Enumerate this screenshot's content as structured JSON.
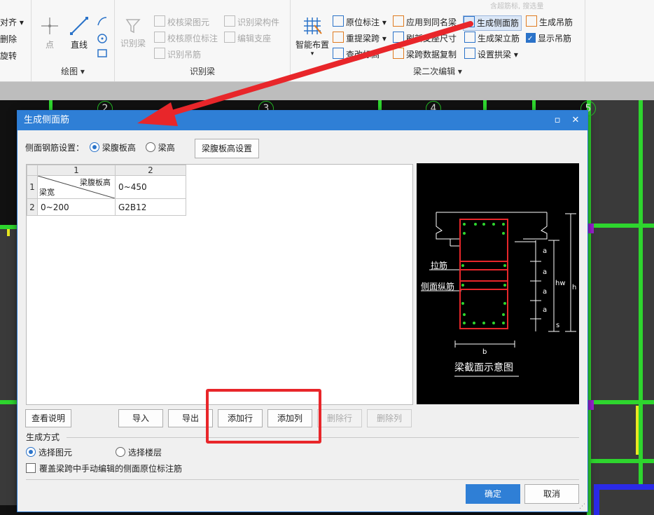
{
  "ribbon": {
    "left_items": [
      "对齐",
      "删除",
      "旋转"
    ],
    "draw_group": {
      "title": "绘图",
      "point": "点",
      "line": "直线"
    },
    "identify_group": {
      "title": "识别梁",
      "big": "识别梁",
      "items": [
        "校核梁图元",
        "校核原位标注",
        "识别吊筋",
        "识别梁构件",
        "编辑支座"
      ]
    },
    "edit_group": {
      "title": "梁二次编辑",
      "smart": "智能布置",
      "items": [
        "原位标注",
        "重提梁跨",
        "查改标高",
        "应用到同名梁",
        "刷新支座尺寸",
        "梁跨数据复制",
        "生成侧面筋",
        "生成架立筋",
        "设置拱梁",
        "生成吊筋",
        "显示吊筋"
      ]
    },
    "overflow_text": "含超筋标, 搜选量"
  },
  "canvas": {
    "axis_labels": [
      "2",
      "3",
      "4",
      "5"
    ]
  },
  "dialog": {
    "title": "生成侧面筋",
    "setting_label": "侧面钢筋设置：",
    "radio_web": "梁腹板高",
    "radio_height": "梁高",
    "web_settings_button": "梁腹板高设置",
    "table": {
      "col_headers": [
        "1",
        "2"
      ],
      "row_headers": [
        "1",
        "2"
      ],
      "diag_top": "梁腹板高",
      "diag_bottom": "梁宽",
      "header_value": "0~450",
      "row_label": "0~200",
      "row_value": "G2B12"
    },
    "preview": {
      "caption": "梁截面示意图",
      "tie_label": "拉筋",
      "side_label": "侧面纵筋",
      "dim_a": "a",
      "dim_hw": "hw",
      "dim_h": "h",
      "dim_s": "s",
      "dim_b": "b"
    },
    "buttons": {
      "help": "查看说明",
      "import": "导入",
      "export": "导出",
      "add_row": "添加行",
      "add_col": "添加列",
      "del_row": "删除行",
      "del_col": "删除列",
      "ok": "确定",
      "cancel": "取消"
    },
    "mode_label": "生成方式",
    "mode_select_element": "选择图元",
    "mode_select_floor": "选择楼层",
    "override_label": "覆盖梁跨中手动编辑的侧面原位标注筋"
  }
}
